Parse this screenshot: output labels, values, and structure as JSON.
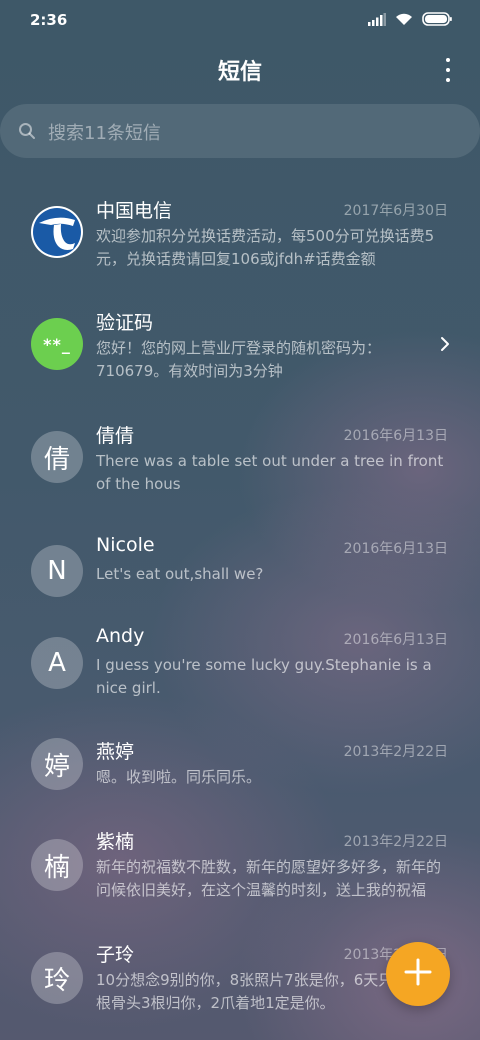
{
  "status_bar": {
    "time": "2:36",
    "icons": [
      "signal-icon",
      "wifi-icon",
      "battery-icon"
    ]
  },
  "header": {
    "title": "短信",
    "more_icon": "more-vertical-icon"
  },
  "search": {
    "placeholder": "搜索11条短信",
    "icon": "search-icon"
  },
  "conversations": [
    {
      "avatar_text": "",
      "avatar_type": "telecom-logo",
      "name": "中国电信",
      "date": "2017年6月30日",
      "preview": "欢迎参加积分兑换话费活动，每500分可兑换话费5元，兑换话费请回复106或jfdh#话费金额"
    },
    {
      "avatar_text": "**_",
      "avatar_type": "verification-code",
      "name": "验证码",
      "date": "",
      "preview": "您好！您的网上营业厅登录的随机密码为：710679。有效时间为3分钟"
    },
    {
      "avatar_text": "倩",
      "avatar_type": "letter",
      "name": "倩倩",
      "date": "2016年6月13日",
      "preview": "There was a table set out under a tree in front of the hous"
    },
    {
      "avatar_text": "N",
      "avatar_type": "letter",
      "name": "Nicole",
      "date": "2016年6月13日",
      "preview": "Let's eat out,shall we?"
    },
    {
      "avatar_text": "A",
      "avatar_type": "letter",
      "name": "Andy",
      "date": "2016年6月13日",
      "preview": "I guess you're some lucky guy.Stephanie is a nice girl."
    },
    {
      "avatar_text": "婷",
      "avatar_type": "letter",
      "name": "燕婷",
      "date": "2013年2月22日",
      "preview": "嗯。收到啦。同乐同乐。"
    },
    {
      "avatar_text": "楠",
      "avatar_type": "letter",
      "name": "紫楠",
      "date": "2013年2月22日",
      "preview": "新年的祝福数不胜数，新年的愿望好多好多，新年的问候依旧美好，在这个温馨的时刻，送上我的祝福"
    },
    {
      "avatar_text": "玲",
      "avatar_type": "letter",
      "name": "子玲",
      "date": "2013年2月22日",
      "preview": "10分想念9别的你，8张照片7张是你，6天只像你，4根骨头3根归你，2爪着地1定是你。"
    }
  ],
  "fab": {
    "icon": "plus-icon",
    "color": "#f5a623"
  },
  "colors": {
    "accent": "#f5a623",
    "verification_avatar": "#6ccf4f",
    "telecom_blue": "#1a5aa6"
  }
}
